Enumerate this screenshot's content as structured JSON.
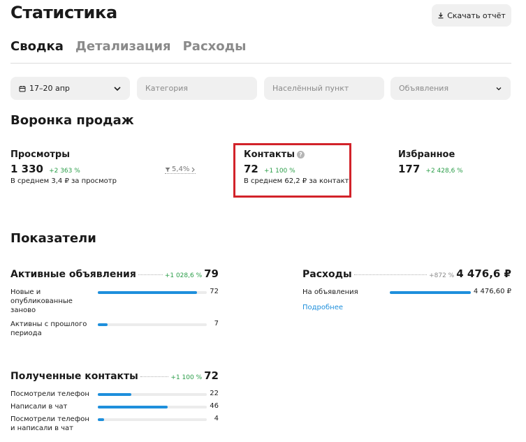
{
  "header": {
    "title": "Статистика",
    "download_label": "Скачать отчёт"
  },
  "tabs": [
    {
      "label": "Сводка",
      "active": true
    },
    {
      "label": "Детализация",
      "active": false
    },
    {
      "label": "Расходы",
      "active": false
    }
  ],
  "filters": {
    "date": "17–20 апр",
    "category_placeholder": "Категория",
    "locality_placeholder": "Населённый пункт",
    "ads_placeholder": "Объявления"
  },
  "funnel": {
    "title": "Воронка продаж",
    "views": {
      "name": "Просмотры",
      "value": "1 330",
      "delta": "+2 363 %",
      "avg": "В среднем 3,4 ₽ за просмотр"
    },
    "conversion": "5,4%",
    "contacts": {
      "name": "Контакты",
      "value": "72",
      "delta": "+1 100 %",
      "avg": "В среднем 62,2 ₽ за контакт"
    },
    "favorites": {
      "name": "Избранное",
      "value": "177",
      "delta": "+2 428,6 %"
    }
  },
  "indicators": {
    "title": "Показатели",
    "active_ads": {
      "name": "Активные объявления",
      "delta": "+1 028,6 %",
      "total": "79",
      "rows": [
        {
          "label": "Новые и опубликованные заново",
          "value": "72",
          "fraction": 0.91
        },
        {
          "label": "Активны с прошлого периода",
          "value": "7",
          "fraction": 0.09
        }
      ]
    },
    "expenses": {
      "name": "Расходы",
      "delta": "+872 %",
      "total": "4 476,6 ₽",
      "rows": [
        {
          "label": "На объявления",
          "value": "4 476,60 ₽",
          "fraction": 1.0
        }
      ],
      "more_link": "Подробнее"
    },
    "contacts_received": {
      "name": "Полученные контакты",
      "delta": "+1 100 %",
      "total": "72",
      "rows": [
        {
          "label": "Посмотрели телефон",
          "value": "22",
          "fraction": 0.31
        },
        {
          "label": "Написали в чат",
          "value": "46",
          "fraction": 0.64
        },
        {
          "label": "Посмотрели телефон и написали в чат",
          "value": "4",
          "fraction": 0.06
        }
      ]
    }
  },
  "colors": {
    "accent": "#1e8fdc",
    "positive": "#2a9d48",
    "highlight": "#d2232a"
  }
}
